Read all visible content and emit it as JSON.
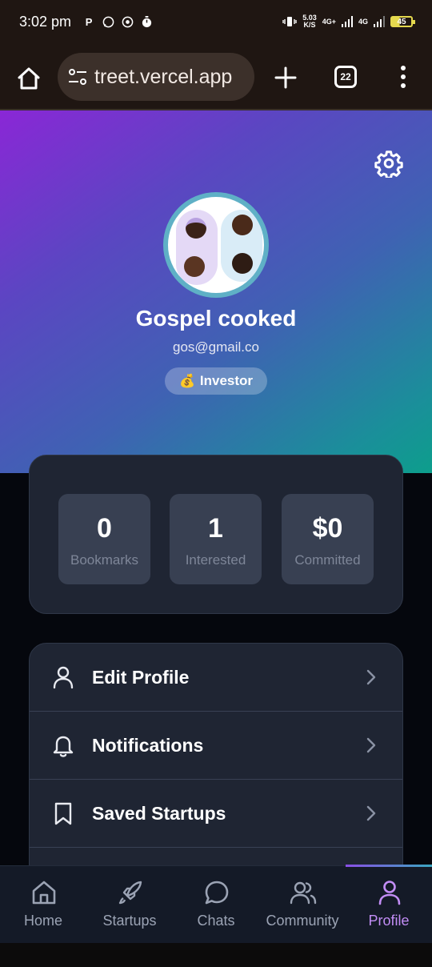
{
  "status_bar": {
    "time": "3:02 pm",
    "notification_icons": [
      "p-icon",
      "whatsapp-icon",
      "messenger-icon",
      "timer-icon"
    ],
    "net_speed_value": "5.03",
    "net_speed_unit": "K/S",
    "signal_1": "4G+",
    "signal_2": "4G",
    "battery_level": "45"
  },
  "browser": {
    "url": "treet.vercel.app",
    "tab_count": "22"
  },
  "profile": {
    "name": "Gospel cooked",
    "email": "gos@gmail.co",
    "role_emoji": "💰",
    "role_label": "Investor"
  },
  "stats": [
    {
      "value": "0",
      "label": "Bookmarks"
    },
    {
      "value": "1",
      "label": "Interested"
    },
    {
      "value": "$0",
      "label": "Committed"
    }
  ],
  "menu": [
    {
      "label": "Edit Profile",
      "icon": "user-icon"
    },
    {
      "label": "Notifications",
      "icon": "bell-icon"
    },
    {
      "label": "Saved Startups",
      "icon": "bookmark-icon"
    }
  ],
  "nav": {
    "active": "Profile",
    "items": [
      {
        "label": "Home",
        "icon": "home-icon"
      },
      {
        "label": "Startups",
        "icon": "rocket-icon"
      },
      {
        "label": "Chats",
        "icon": "chat-icon"
      },
      {
        "label": "Community",
        "icon": "users-icon"
      },
      {
        "label": "Profile",
        "icon": "user-icon"
      }
    ]
  },
  "colors": {
    "accent": "#c28df5",
    "card_bg": "#1f2533",
    "stat_bg": "#384052",
    "page_bg": "#05070d"
  }
}
